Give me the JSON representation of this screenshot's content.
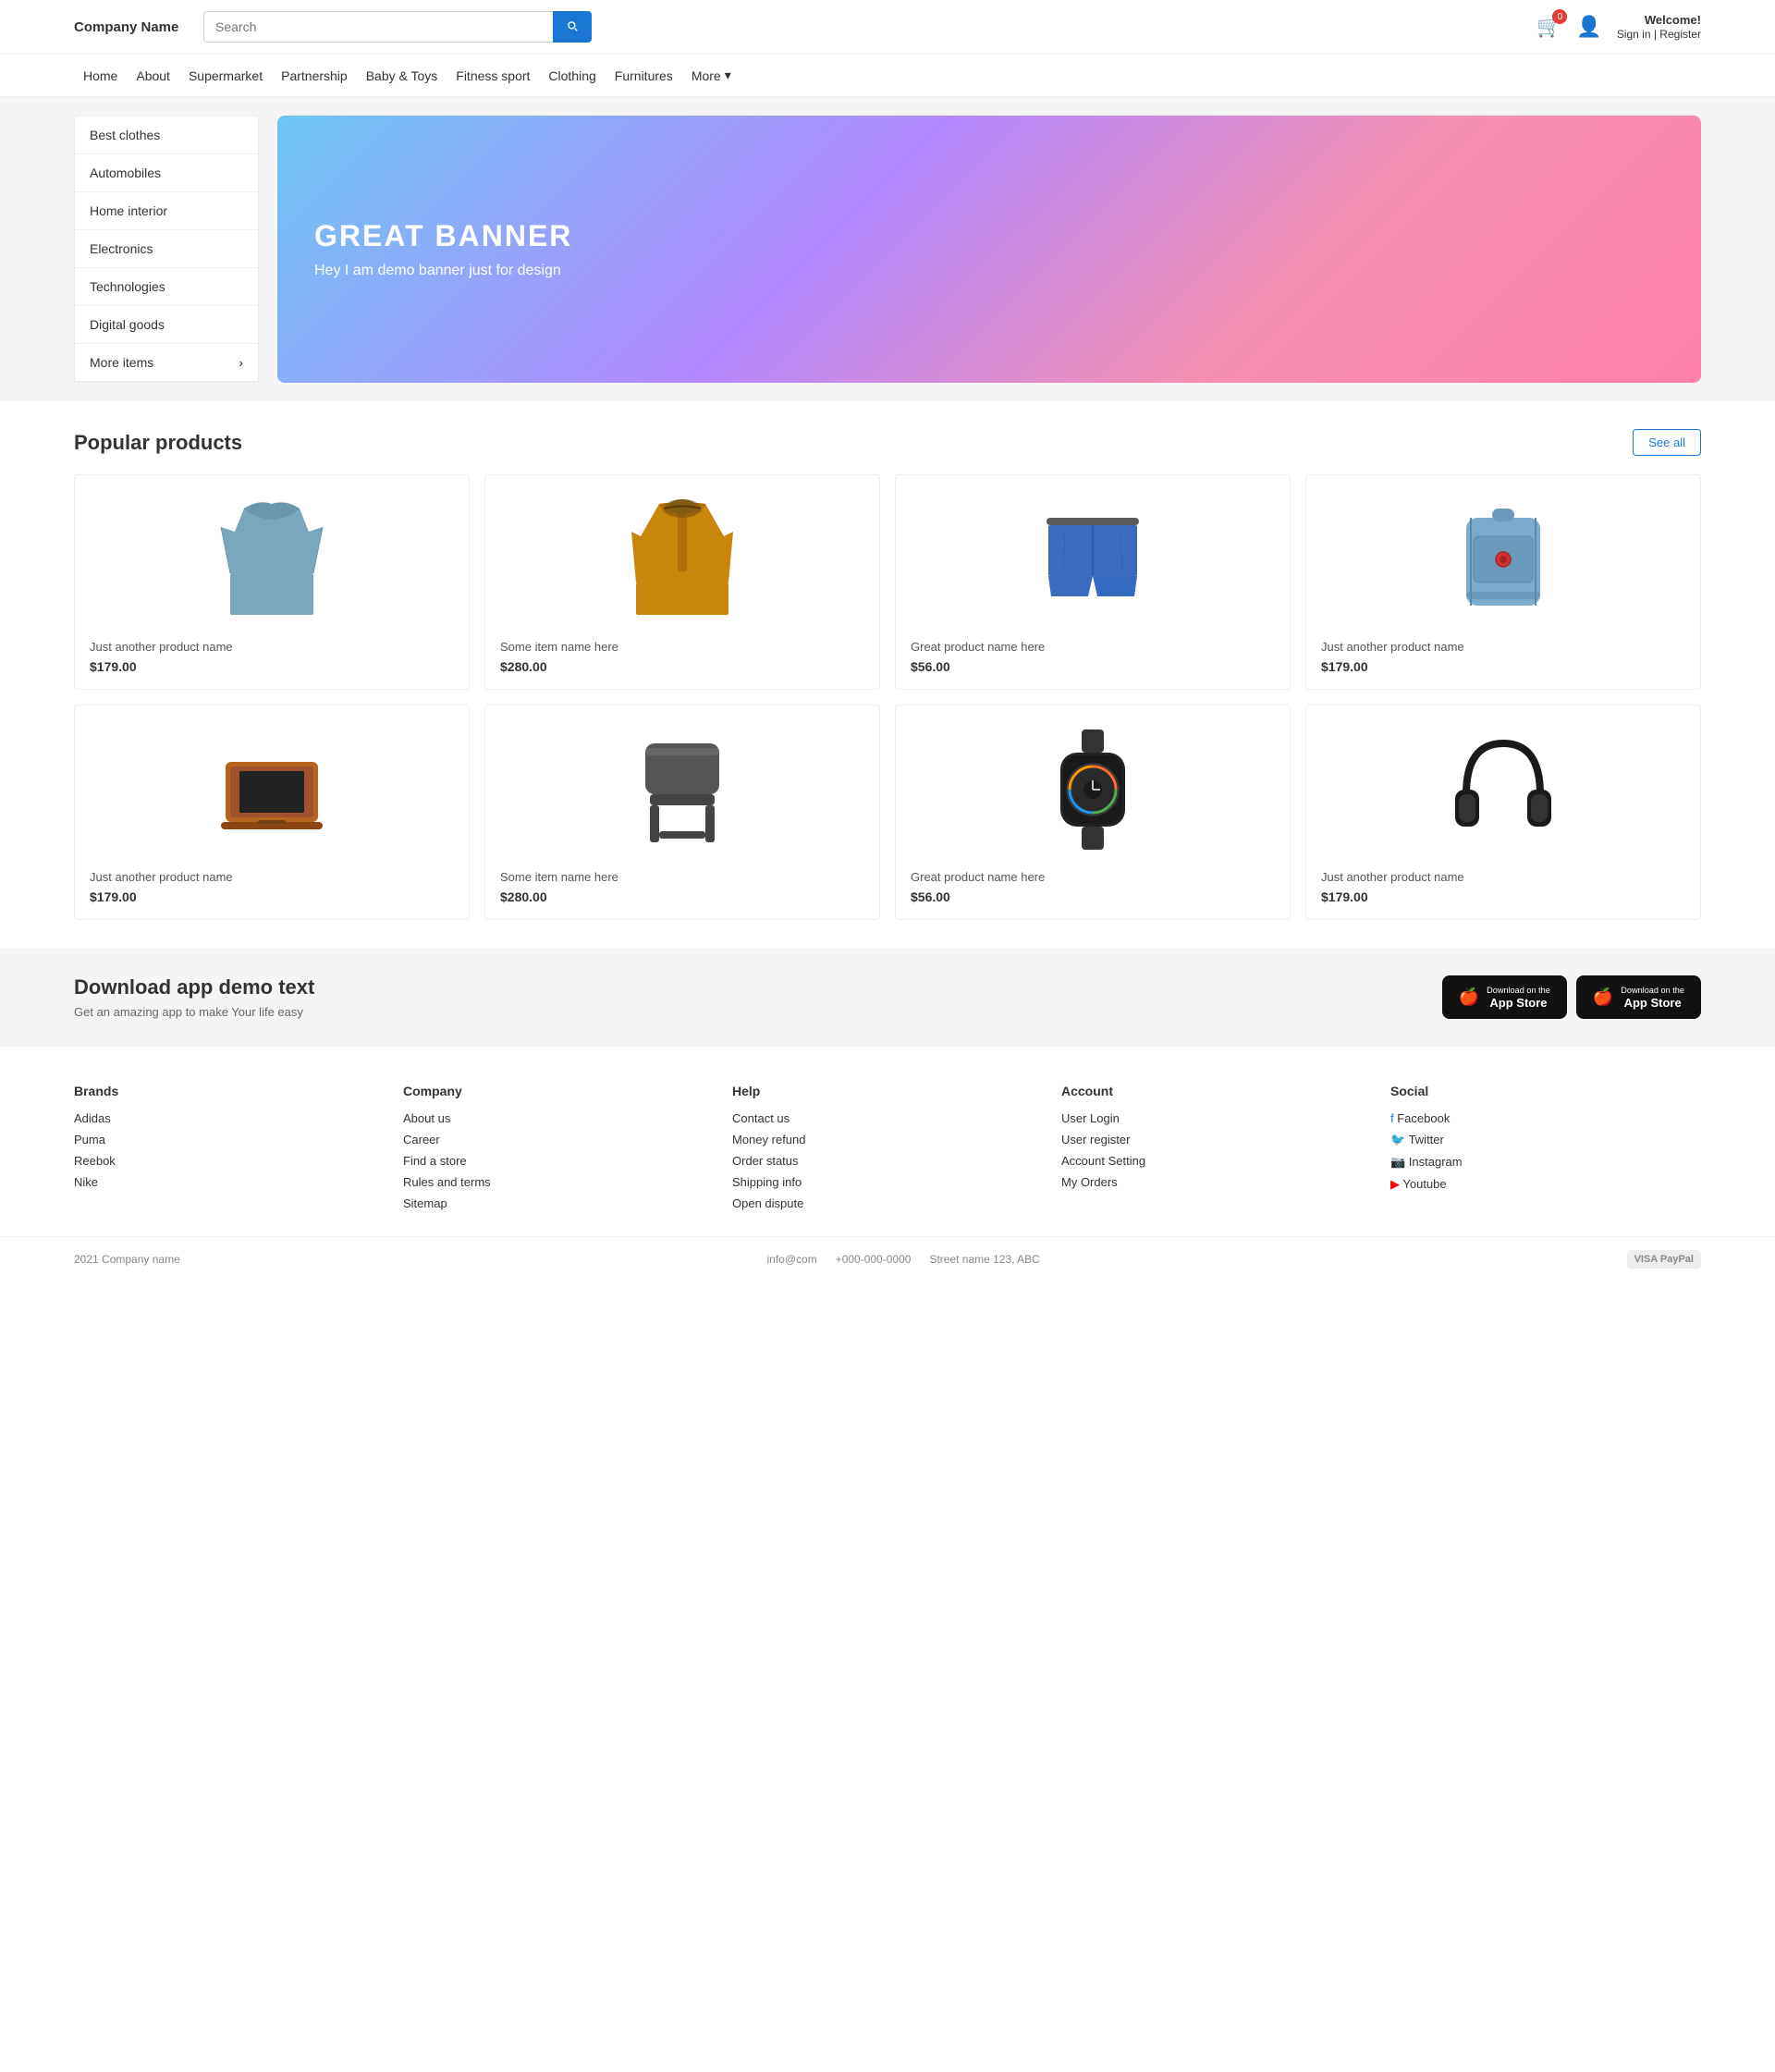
{
  "header": {
    "logo": "Company Name",
    "search_placeholder": "Search",
    "cart_count": "0",
    "welcome": "Welcome!",
    "signin_register": "Sign in | Register"
  },
  "nav": {
    "items": [
      {
        "label": "Home"
      },
      {
        "label": "About"
      },
      {
        "label": "Supermarket"
      },
      {
        "label": "Partnership"
      },
      {
        "label": "Baby &amp; Toys"
      },
      {
        "label": "Fitness sport"
      },
      {
        "label": "Clothing"
      },
      {
        "label": "Furnitures"
      },
      {
        "label": "More"
      }
    ]
  },
  "sidebar": {
    "items": [
      {
        "label": "Best clothes"
      },
      {
        "label": "Automobiles"
      },
      {
        "label": "Home interior"
      },
      {
        "label": "Electronics"
      },
      {
        "label": "Technologies"
      },
      {
        "label": "Digital goods"
      },
      {
        "label": "More items"
      }
    ]
  },
  "banner": {
    "title": "GREAT BANNER",
    "subtitle": "Hey I am demo banner just for design"
  },
  "products": {
    "section_title": "Popular products",
    "see_all": "See all",
    "items": [
      {
        "name": "Just another product name",
        "price": "$179.00",
        "type": "polo"
      },
      {
        "name": "Some item name here",
        "price": "$280.00",
        "type": "jacket"
      },
      {
        "name": "Great product name here",
        "price": "$56.00",
        "type": "shorts"
      },
      {
        "name": "Just another product name",
        "price": "$179.00",
        "type": "backpack"
      },
      {
        "name": "Just another product name",
        "price": "$179.00",
        "type": "laptop"
      },
      {
        "name": "Some item name here",
        "price": "$280.00",
        "type": "chair"
      },
      {
        "name": "Great product name here",
        "price": "$56.00",
        "type": "watch"
      },
      {
        "name": "Just another product name",
        "price": "$179.00",
        "type": "headphones"
      }
    ]
  },
  "app_section": {
    "title": "Download app demo text",
    "subtitle": "Get an amazing app to make Your life easy",
    "btn1_top": "Download on the",
    "btn1_label": "App Store",
    "btn2_top": "Download on the",
    "btn2_label": "App Store"
  },
  "footer": {
    "brands": {
      "title": "Brands",
      "links": [
        "Adidas",
        "Puma",
        "Reebok",
        "Nike"
      ]
    },
    "company": {
      "title": "Company",
      "links": [
        "About us",
        "Career",
        "Find a store",
        "Rules and terms",
        "Sitemap"
      ]
    },
    "help": {
      "title": "Help",
      "links": [
        "Contact us",
        "Money refund",
        "Order status",
        "Shipping info",
        "Open dispute"
      ]
    },
    "account": {
      "title": "Account",
      "links": [
        "User Login",
        "User register",
        "Account Setting",
        "My Orders"
      ]
    },
    "social": {
      "title": "Social",
      "links": [
        {
          "label": "Facebook",
          "icon": "fb"
        },
        {
          "label": "Twitter",
          "icon": "tw"
        },
        {
          "label": "Instagram",
          "icon": "ig"
        },
        {
          "label": "Youtube",
          "icon": "yt"
        }
      ]
    }
  },
  "footer_bottom": {
    "copyright": "2021 Company name",
    "email": "info@com",
    "phone": "+000-000-0000",
    "address": "Street name 123, ABC",
    "payment": "VISA PayPal"
  }
}
